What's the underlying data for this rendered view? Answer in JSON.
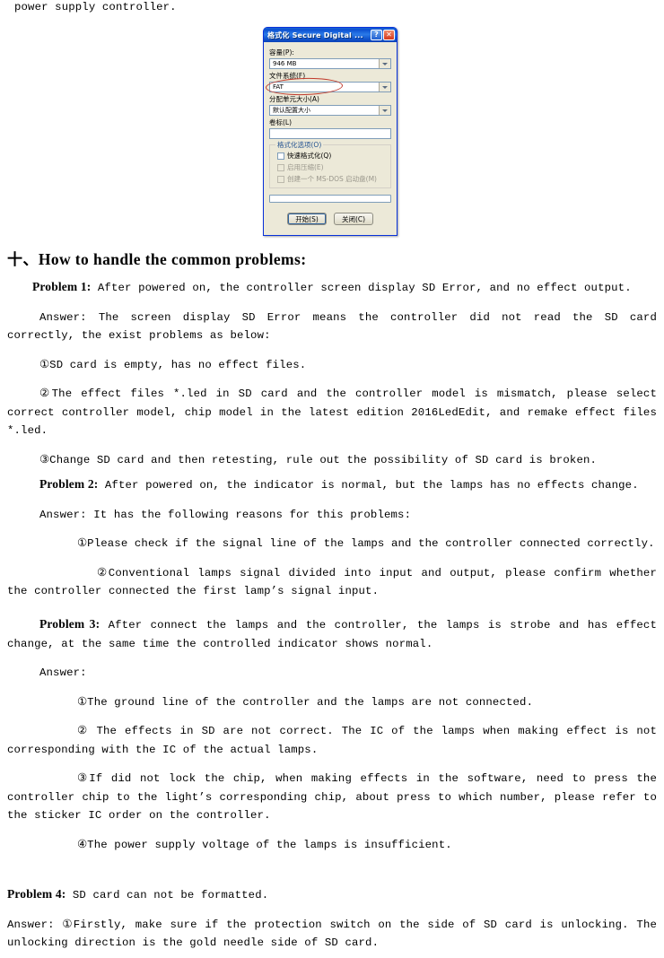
{
  "document": {
    "top_fragment": "power supply controller.",
    "section_heading_prefix": "十、",
    "section_heading": "How to handle the common problems:",
    "problems": [
      {
        "label": "Problem 1:",
        "statement": " After powered on, the controller screen display SD Error, and no effect output.",
        "answer": "Answer: The screen display SD Error means the controller did not read the SD card correctly, the exist problems as below:",
        "items": [
          "①SD card is empty, has no effect files.",
          "②The effect files *.led in SD card and the controller model is mismatch, please select correct controller model, chip model in the latest edition 2016LedEdit, and remake effect files *.led.",
          "③Change SD card and then retesting, rule out the possibility of SD card is broken."
        ]
      },
      {
        "label": "Problem 2:",
        "statement": " After powered on, the indicator is normal, but the lamps has no effects change.",
        "answer": "Answer: It has the following reasons for this problems:",
        "items": [
          "①Please check if the signal line of the lamps and the controller connected correctly.",
          "②Conventional lamps signal divided into input and output, please confirm whether the controller connected the first lamp’s  signal input."
        ]
      },
      {
        "label": "Problem 3:",
        "statement": " After connect the lamps and the controller, the lamps is strobe and has effect change, at the same time the controlled indicator shows normal.",
        "answer": "Answer:",
        "items": [
          "①The ground line of the controller and the lamps are not connected.",
          "② The effects in SD are not correct. The IC of the lamps when making effect is not corresponding with the IC of the actual lamps.",
          "③If did not lock the chip, when making effects in the software, need to press the controller chip to the light’s corresponding chip, about press to which number, please refer to the sticker IC order on the controller.",
          "④The power supply voltage of the lamps is insufficient."
        ]
      },
      {
        "label": "Problem 4:",
        "statement": "  SD card can not be formatted.",
        "answer": "Answer: ①Firstly, make sure if the protection switch on the side of SD card is unlocking. The unlocking direction is the gold needle side of SD card.",
        "items": []
      }
    ]
  },
  "dialog": {
    "title": "格式化 Secure Digital ...",
    "help_button": "?",
    "close_button": "✕",
    "capacity_label": "容量(P):",
    "capacity_value": "946 MB",
    "filesystem_label": "文件系统(F)",
    "filesystem_value": "FAT",
    "allocation_label": "分配单元大小(A)",
    "allocation_value": "默认配置大小",
    "volume_label": "卷标(L)",
    "volume_value": "",
    "options_group_title": "格式化选项(O)",
    "quick_format_label": "快速格式化(Q)",
    "enable_compression_label": "启用压缩(E)",
    "create_msdos_label": "创建一个 MS-DOS 启动盘(M)",
    "start_button": "开始(S)",
    "close_dialog_button": "关闭(C)",
    "highlight_color": "#c0392b",
    "titlebar_color": "#0a4fd0"
  }
}
